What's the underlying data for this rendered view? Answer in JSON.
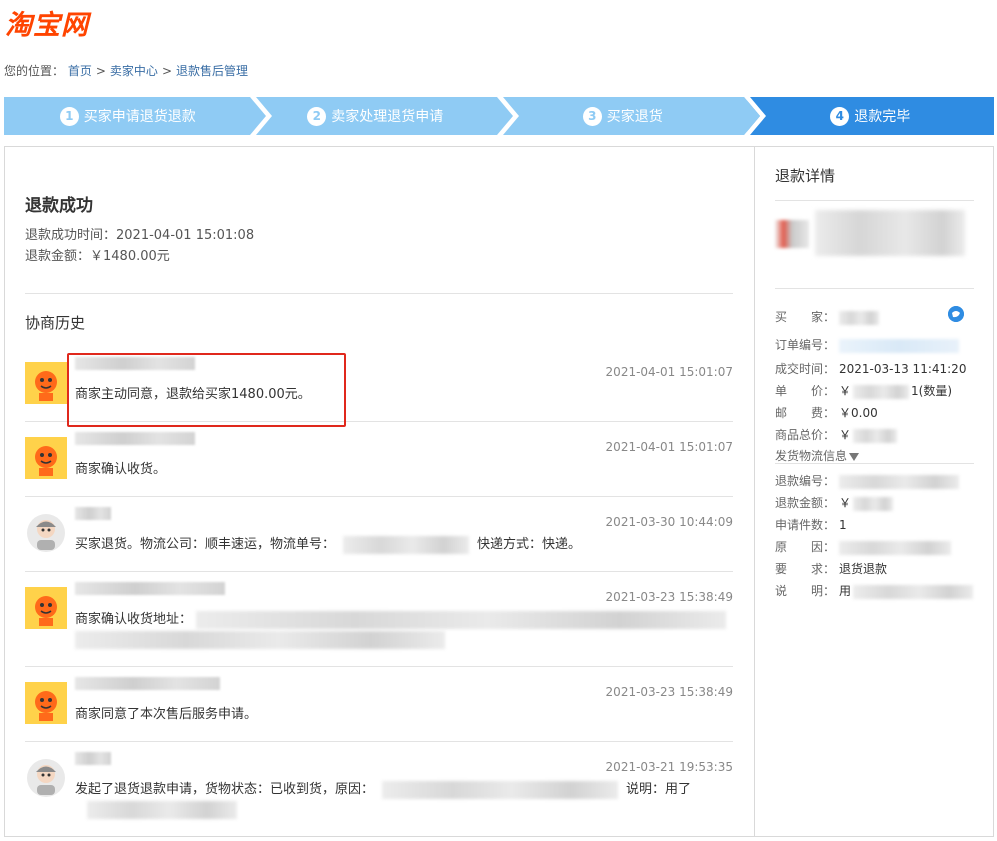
{
  "logo": "淘宝网",
  "breadcrumb": {
    "prefix": "您的位置：",
    "items": [
      "首页",
      "卖家中心",
      "退款售后管理"
    ],
    "sep": ">"
  },
  "steps": [
    {
      "num": "1",
      "label": "买家申请退货退款"
    },
    {
      "num": "2",
      "label": "卖家处理退货申请"
    },
    {
      "num": "3",
      "label": "买家退货"
    },
    {
      "num": "4",
      "label": "退款完毕"
    }
  ],
  "result": {
    "title": "退款成功",
    "time_label": "退款成功时间：",
    "time": "2021-04-01 15:01:08",
    "amount_label": "退款金额：",
    "amount": "￥1480.00元"
  },
  "history": {
    "title": "协商历史",
    "records": [
      {
        "role": "seller",
        "time": "2021-04-01 15:01:07",
        "msg": "商家主动同意，退款给买家1480.00元。"
      },
      {
        "role": "seller",
        "time": "2021-04-01 15:01:07",
        "msg": "商家确认收货。"
      },
      {
        "role": "buyer",
        "time": "2021-03-30 10:44:09",
        "msg": "买家退货。物流公司：顺丰速运，物流单号：",
        "msg_tail": "快递方式：快递。"
      },
      {
        "role": "seller",
        "time": "2021-03-23 15:38:49",
        "msg": "商家确认收货地址："
      },
      {
        "role": "seller",
        "time": "2021-03-23 15:38:49",
        "msg": "商家同意了本次售后服务申请。"
      },
      {
        "role": "buyer",
        "time": "2021-03-21 19:53:35",
        "msg": "发起了退货退款申请，货物状态：已收到货，原因：",
        "msg_tail": "说明：用了"
      }
    ]
  },
  "detail": {
    "title": "退款详情",
    "rows1": [
      {
        "label": "买　　家：",
        "value": ""
      },
      {
        "label": "订单编号：",
        "value": ""
      },
      {
        "label": "成交时间：",
        "value": "2021-03-13 11:41:20"
      },
      {
        "label": "单　　价：",
        "value": "￥",
        "tail": "1(数量)"
      },
      {
        "label": "邮　　费：",
        "value": "￥0.00"
      },
      {
        "label": "商品总价：",
        "value": "￥"
      }
    ],
    "logistics": "发货物流信息",
    "rows2": [
      {
        "label": "退款编号：",
        "value": ""
      },
      {
        "label": "退款金额：",
        "value": "￥"
      },
      {
        "label": "申请件数：",
        "value": "1"
      },
      {
        "label": "原　　因：",
        "value": ""
      },
      {
        "label": "要　　求：",
        "value": "退货退款"
      },
      {
        "label": "说　　明：",
        "value": "用"
      }
    ]
  },
  "colors": {
    "step_light": "#8fcbf4",
    "step_active": "#2f8ce2",
    "highlight": "#e0281c",
    "logo": "#ff4400"
  }
}
